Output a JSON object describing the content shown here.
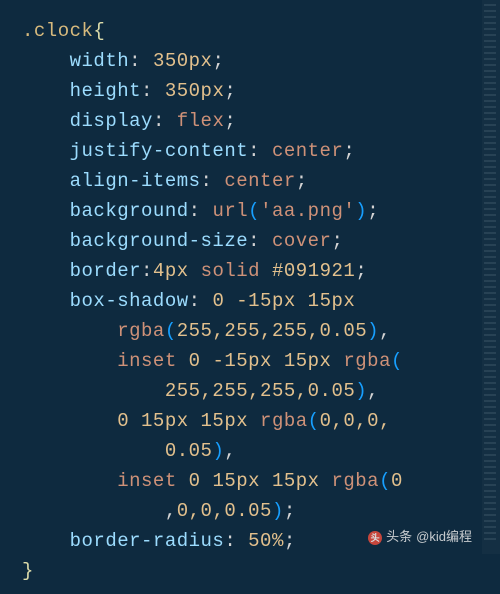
{
  "code": {
    "selector": ".clock",
    "open_brace": "{",
    "close_brace": "}",
    "lines": [
      {
        "indent": 1,
        "prop": "width",
        "colon": ": ",
        "value": "350px",
        "semi": ";"
      },
      {
        "indent": 1,
        "prop": "height",
        "colon": ": ",
        "value": "350px",
        "semi": ";"
      },
      {
        "indent": 1,
        "prop": "display",
        "colon": ": ",
        "value": "flex",
        "semi": ";"
      },
      {
        "indent": 1,
        "prop": "justify-content",
        "colon": ": ",
        "value": "center",
        "semi": ";"
      },
      {
        "indent": 1,
        "prop": "align-items",
        "colon": ": ",
        "value": "center",
        "semi": ";"
      },
      {
        "indent": 1,
        "prop": "background",
        "colon": ": ",
        "func": "url",
        "arg_str": "'aa.png'",
        "semi": ";"
      },
      {
        "indent": 1,
        "prop": "background-size",
        "colon": ": ",
        "value": "cover",
        "semi": ";"
      },
      {
        "indent": 1,
        "prop": "border",
        "colon": ":",
        "parts": [
          "4px",
          " ",
          "solid",
          " ",
          "#091921"
        ],
        "semi": ";"
      },
      {
        "indent": 1,
        "prop": "box-shadow",
        "colon": ": ",
        "shadow_start": "0 -15px 15px"
      },
      {
        "indent": 2,
        "func": "rgba",
        "args": "255,255,255,0.05",
        "comma": ","
      },
      {
        "indent": 2,
        "inset": "inset ",
        "mid": "0 -15px 15px ",
        "func": "rgba",
        "open_only": true
      },
      {
        "indent": 3,
        "args_only": "255,255,255,0.05",
        "close": ")",
        "comma": ","
      },
      {
        "indent": 2,
        "mid": "0 15px 15px ",
        "func": "rgba",
        "args": "0,0,0,",
        "cont": true
      },
      {
        "indent": 3,
        "args_only": "0.05",
        "close": ")",
        "comma": ","
      },
      {
        "indent": 2,
        "inset": "inset ",
        "mid": "0 15px 15px ",
        "func": "rgba",
        "args": "0",
        "cont": true
      },
      {
        "indent": 3,
        "lead_comma": ",",
        "args_only": "0,0,0.05",
        "close": ")",
        "semi": ";"
      },
      {
        "indent": 1,
        "prop": "border-radius",
        "colon": ": ",
        "value": "50%",
        "semi": ";"
      }
    ]
  },
  "watermark": {
    "label": "头条",
    "author": "@kid编程"
  }
}
